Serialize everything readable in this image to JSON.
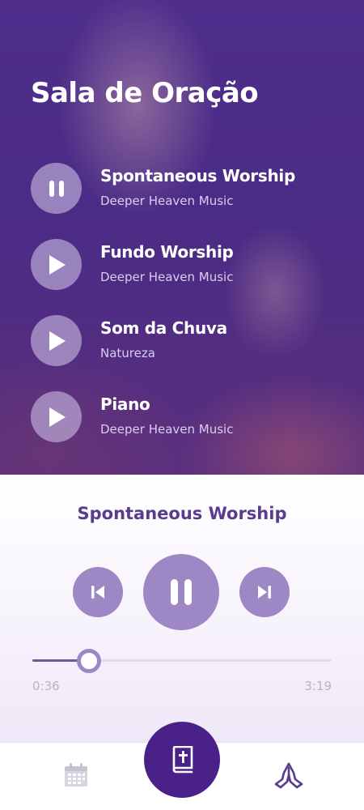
{
  "header": {
    "title": "Sala de Oração"
  },
  "tracks": [
    {
      "title": "Spontaneous Worship",
      "artist": "Deeper Heaven Music",
      "state": "pause-icon"
    },
    {
      "title": "Fundo Worship",
      "artist": "Deeper Heaven Music",
      "state": "play-icon"
    },
    {
      "title": "Som da Chuva",
      "artist": "Natureza",
      "state": "play-icon"
    },
    {
      "title": "Piano",
      "artist": "Deeper Heaven Music",
      "state": "play-icon"
    }
  ],
  "player": {
    "now_playing": "Spontaneous Worship",
    "current_time": "0:36",
    "total_time": "3:19",
    "progress": 0.19
  },
  "nav": {
    "items": [
      "calendar-icon",
      "bible-icon",
      "praying-hands-icon"
    ],
    "active": "bible-icon"
  },
  "colors": {
    "accent": "#4a2188",
    "control": "#9d87c4",
    "hero_overlay": "#4f2e8c"
  }
}
